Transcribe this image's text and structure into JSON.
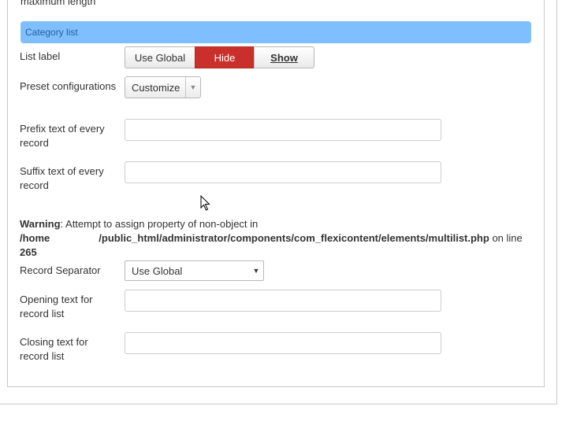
{
  "cut_off_label": "maximum length",
  "section": {
    "title": "Category list"
  },
  "list_label": {
    "label": "List label",
    "options": [
      "Use Global",
      "Hide",
      "Show"
    ],
    "selected": "Hide"
  },
  "preset": {
    "label": "Preset configurations",
    "value": "Customize"
  },
  "prefix": {
    "label": "Prefix text of every record",
    "value": ""
  },
  "suffix": {
    "label": "Suffix text of every record",
    "value": ""
  },
  "warning": {
    "title": "Warning",
    "message": ": Attempt to assign property of non-object in",
    "path_start": "/home",
    "path_end": "/public_html/administrator/components/com_flexicontent/elements/multilist.php",
    "on_line_text": " on line",
    "line_number": "265"
  },
  "separator": {
    "label": "Record Separator",
    "value": "Use Global"
  },
  "opening": {
    "label": "Opening text for record list",
    "value": ""
  },
  "closing": {
    "label": "Closing text for record list",
    "value": ""
  },
  "colors": {
    "section_header_bg": "#7fbfff",
    "hide_active": "#c9302c"
  },
  "icons": {
    "caret": "chevron-down-icon",
    "cursor": "mouse-pointer-icon"
  }
}
